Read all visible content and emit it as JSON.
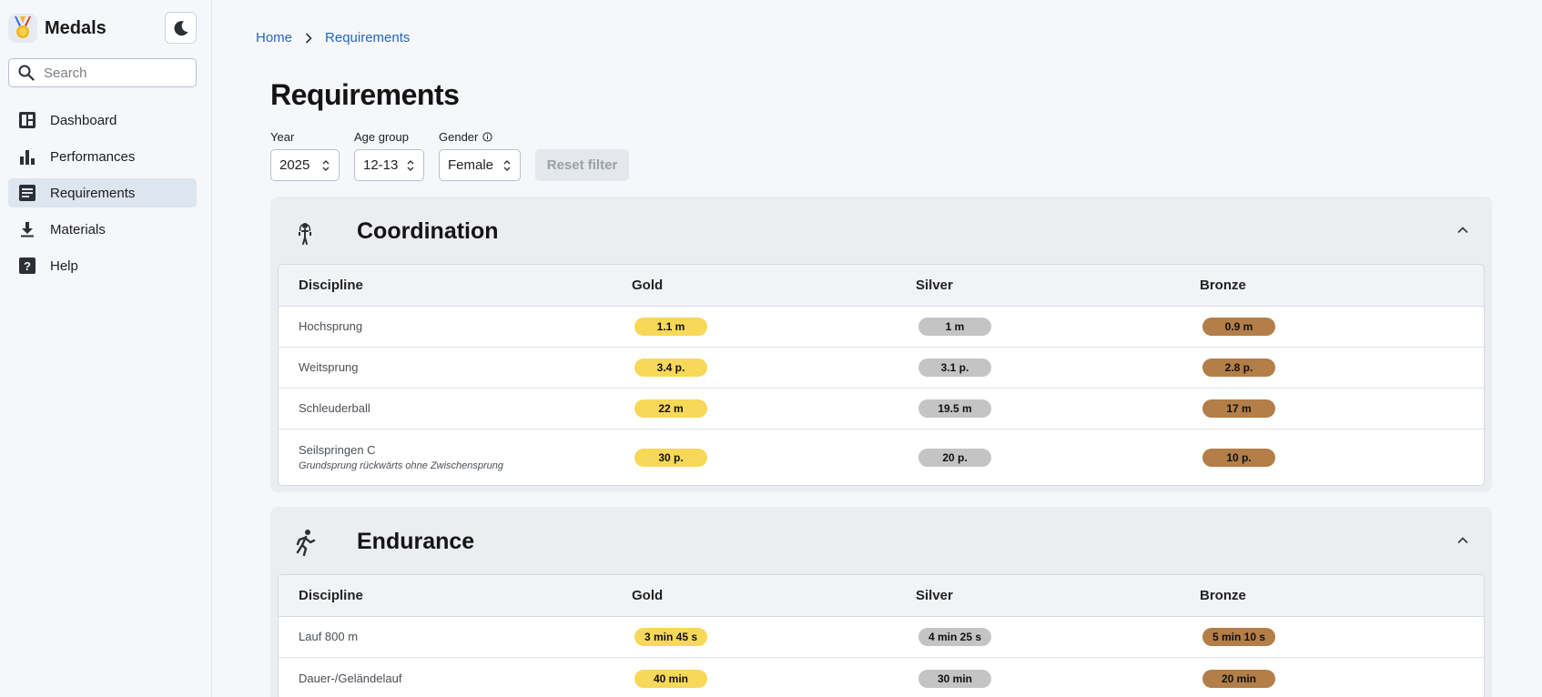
{
  "app": {
    "name": "Medals"
  },
  "search": {
    "placeholder": "Search"
  },
  "nav": [
    {
      "label": "Dashboard",
      "icon": "dashboard-icon"
    },
    {
      "label": "Performances",
      "icon": "bar-chart-icon"
    },
    {
      "label": "Requirements",
      "icon": "list-icon",
      "active": true
    },
    {
      "label": "Materials",
      "icon": "download-icon"
    },
    {
      "label": "Help",
      "icon": "help-icon"
    }
  ],
  "breadcrumb": {
    "home": "Home",
    "current": "Requirements"
  },
  "page": {
    "title": "Requirements"
  },
  "filters": {
    "year": {
      "label": "Year",
      "value": "2025"
    },
    "age_group": {
      "label": "Age group",
      "value": "12-13"
    },
    "gender": {
      "label": "Gender",
      "value": "Female"
    },
    "reset": "Reset filter"
  },
  "columns": {
    "discipline": "Discipline",
    "gold": "Gold",
    "silver": "Silver",
    "bronze": "Bronze"
  },
  "sections": [
    {
      "title": "Coordination",
      "icon": "jump-rope-icon",
      "rows": [
        {
          "discipline": "Hochsprung",
          "gold": "1.1 m",
          "silver": "1 m",
          "bronze": "0.9 m"
        },
        {
          "discipline": "Weitsprung",
          "gold": "3.4 p.",
          "silver": "3.1 p.",
          "bronze": "2.8 p."
        },
        {
          "discipline": "Schleuderball",
          "gold": "22 m",
          "silver": "19.5 m",
          "bronze": "17 m"
        },
        {
          "discipline": "Seilspringen C",
          "note": "Grundsprung rückwärts ohne Zwischensprung",
          "gold": "30 p.",
          "silver": "20 p.",
          "bronze": "10 p."
        }
      ]
    },
    {
      "title": "Endurance",
      "icon": "running-icon",
      "rows": [
        {
          "discipline": "Lauf 800 m",
          "gold": "3 min 45 s",
          "silver": "4 min 25 s",
          "bronze": "5 min 10 s"
        },
        {
          "discipline": "Dauer-/Geländelauf",
          "gold": "40 min",
          "silver": "30 min",
          "bronze": "20 min"
        }
      ]
    }
  ],
  "colors": {
    "gold": "#f7d858",
    "silver": "#c4c4c4",
    "bronze": "#b37e47",
    "link": "#2566b8"
  }
}
